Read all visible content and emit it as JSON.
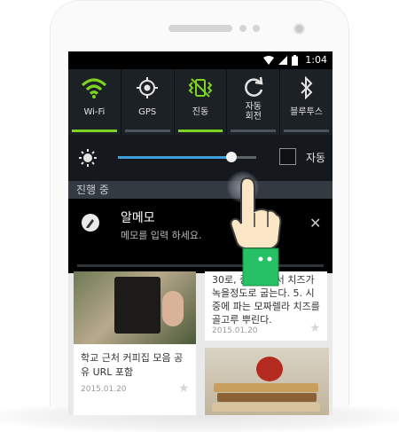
{
  "status_bar": {
    "time": "1:04"
  },
  "quick_toggles": [
    {
      "label": "Wi-Fi",
      "icon": "wifi-icon",
      "on": true
    },
    {
      "label": "GPS",
      "icon": "gps-icon",
      "on": false
    },
    {
      "label": "진동",
      "icon": "vibrate-icon",
      "on": true
    },
    {
      "label": "자동\n회전",
      "icon": "auto-rotate-icon",
      "on": false
    },
    {
      "label": "블루투스",
      "icon": "bluetooth-icon",
      "on": false
    }
  ],
  "brightness": {
    "level": 0.82,
    "auto_label": "자동",
    "auto_checked": false
  },
  "section_title": "진행 중",
  "notification": {
    "title": "알메모",
    "text": "메모를 입력 하세요."
  },
  "background_app": {
    "card1": {
      "text": "학교 근처 커피집 모음 공유 URL 포함",
      "date": "2015.01.20"
    },
    "card2": {
      "text": "30로, 중간불에서 치즈가 녹을정도로 굽는다. 5. 시중에 파는 모짜렐라 치즈를 골고루 뿌린다.",
      "date": "2015.01.20"
    }
  },
  "colors": {
    "accent_on": "#7ed321",
    "slider": "#3ea0da",
    "hand_cuff": "#26c165"
  }
}
